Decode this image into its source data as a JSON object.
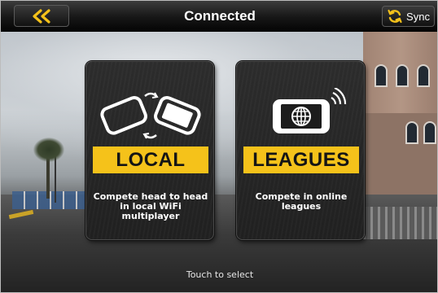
{
  "header": {
    "title": "Connected",
    "sync_label": "Sync",
    "back_icon": "double-chevron-left-icon",
    "sync_icon": "sync-icon"
  },
  "modes": [
    {
      "label": "LOCAL",
      "description": "Compete head to head in local WiFi multiplayer",
      "icon": "two-phones-swap-icon"
    },
    {
      "label": "LEAGUES",
      "description": "Compete in online leagues",
      "icon": "phone-globe-wifi-icon"
    }
  ],
  "footer": {
    "hint": "Touch to select"
  },
  "colors": {
    "accent": "#f5c21a",
    "card": "#262626",
    "topbar": "#111111"
  }
}
